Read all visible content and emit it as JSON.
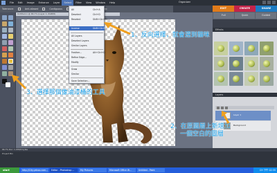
{
  "menubar": {
    "items": [
      "File",
      "Edit",
      "Image",
      "Enhance",
      "Layer",
      "Select",
      "Filter",
      "View",
      "Window",
      "Help"
    ],
    "organizer_label": "Organizer"
  },
  "options": {
    "items": [
      "Tolerance:",
      "Anti-aliased",
      "Contiguous",
      "Sample All Layers",
      "Opacity:"
    ]
  },
  "tabs": {
    "edit": "EDIT",
    "create": "CREATE",
    "share": "SHARE"
  },
  "subtabs": [
    "Full",
    "Quick",
    "Guided"
  ],
  "document": {
    "title": "Untitled-1 @ 66.7% (Layer 1, RGB/8)"
  },
  "select_menu": {
    "items": [
      {
        "label": "All",
        "shortcut": "Ctrl+A"
      },
      {
        "label": "Deselect",
        "shortcut": "Ctrl+D"
      },
      {
        "label": "Reselect",
        "shortcut": "Shift+Ctrl+D"
      },
      {
        "label": "Inverse",
        "shortcut": "Shift+Ctrl+I"
      },
      {
        "label": "All Layers",
        "shortcut": ""
      },
      {
        "label": "Deselect Layers",
        "shortcut": ""
      },
      {
        "label": "Similar Layers",
        "shortcut": ""
      },
      {
        "label": "Feather...",
        "shortcut": "Alt+Ctrl+D"
      },
      {
        "label": "Refine Edge...",
        "shortcut": ""
      },
      {
        "label": "Modify",
        "shortcut": ""
      },
      {
        "label": "Grow",
        "shortcut": ""
      },
      {
        "label": "Similar",
        "shortcut": ""
      },
      {
        "label": "Save Selection...",
        "shortcut": ""
      }
    ]
  },
  "effects_panel": {
    "title": "Effects"
  },
  "layers_panel": {
    "title": "Layers",
    "layers": [
      "Layer 1",
      "Background"
    ]
  },
  "annotations": {
    "a1": "1、反向選擇，就會選到貓咪",
    "a2_line1": "2、在原圖層上新增加",
    "a2_line2": "一個空白的圖層",
    "a3": "3、選擇那個像油漆桶的工具"
  },
  "statusbar": {
    "text": "66.7%   Doc: 1.15M/0 bytes"
  },
  "projectbin": {
    "label": "Project Bin"
  },
  "taskbar": {
    "start": "start",
    "tasks": [
      "http://City.yahoo.com...",
      "Editor - Photoshop ...",
      "My Pictures",
      "Microsoft Office W...",
      "Untitled - Paint"
    ],
    "lang": "CH",
    "clock": "下午 02:35"
  },
  "colors": {
    "annotation": "#1a9fe8",
    "arrow": "#f0a020",
    "edit_tab": "#e07b1a",
    "create_tab": "#c4244a",
    "share_tab": "#1e7bc2"
  }
}
